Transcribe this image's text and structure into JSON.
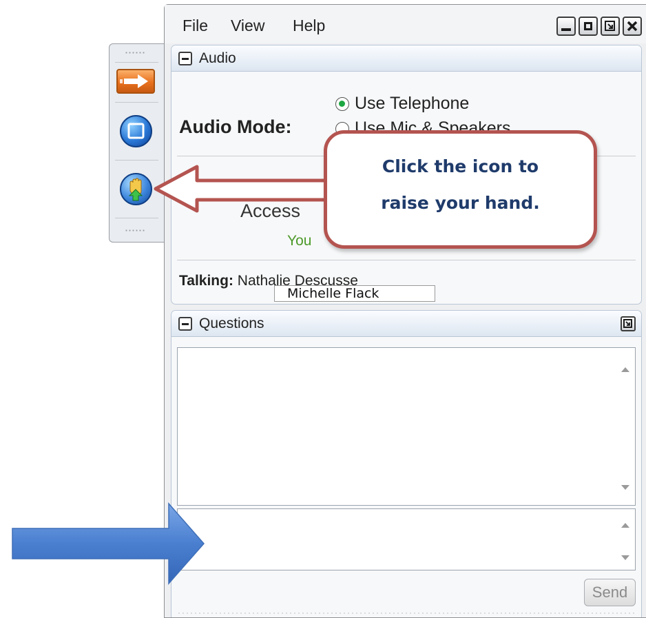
{
  "menu": {
    "items": [
      {
        "label": "File"
      },
      {
        "label": "View"
      },
      {
        "label": "Help"
      }
    ]
  },
  "audio_panel": {
    "title": "Audio",
    "mode_label": "Audio Mode:",
    "options": [
      {
        "label": "Use Telephone",
        "selected": true
      },
      {
        "label": "Use Mic & Speakers",
        "selected": false
      }
    ],
    "access_text": "Access",
    "you_text": "You",
    "talking_label": "Talking:",
    "talking_name": "Nathalie Descusse"
  },
  "questions_panel": {
    "title": "Questions",
    "send_label": "Send"
  },
  "overlay": {
    "callout_lines": [
      "Click the icon to",
      "raise your hand."
    ],
    "name_tag": "Michelle Flack"
  },
  "colors": {
    "callout_border": "#b45450",
    "callout_text": "#1f3b6b",
    "blue_arrow": "#4a7fd0",
    "radio_selected": "#1da742"
  },
  "icons": {
    "toolbar": [
      "arrow-right-icon",
      "window-icon",
      "raise-hand-icon"
    ]
  }
}
